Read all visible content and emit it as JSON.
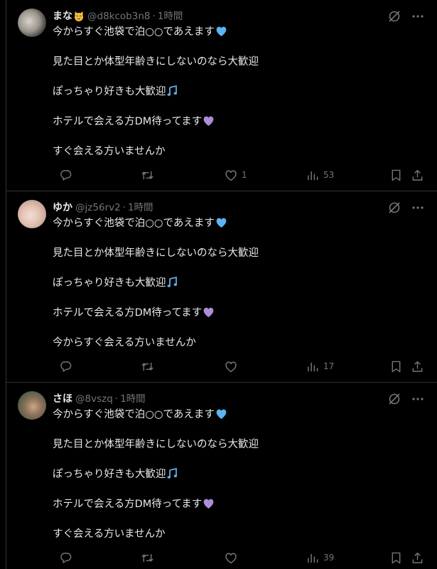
{
  "posts": [
    {
      "name": "まな",
      "name_emoji": "smiling-cat-emoji",
      "handle": "@d8kcob3n8",
      "separator": "·",
      "time": "1時間",
      "lines": [
        "今からすぐ池袋で泊○○であえます",
        "見た目とか体型年齢きにしないのなら大歓迎",
        "ぽっちゃり好きも大歓迎",
        "ホテルで会える方DM待ってます",
        "すぐ会える方いませんか"
      ],
      "likes": "1",
      "views": "53"
    },
    {
      "name": "ゆか",
      "name_emoji": "",
      "handle": "@jz56rv2",
      "separator": "·",
      "time": "1時間",
      "lines": [
        "今からすぐ池袋で泊○○であえます",
        "見た目とか体型年齢きにしないのなら大歓迎",
        "ぽっちゃり好きも大歓迎",
        "ホテルで会える方DM待ってます",
        "今からすぐ会える方いませんか"
      ],
      "likes": "",
      "views": "17"
    },
    {
      "name": "さほ",
      "name_emoji": "",
      "handle": "@8vszq",
      "separator": "·",
      "time": "1時間",
      "lines": [
        "今からすぐ池袋で泊○○であえます",
        "見た目とか体型年齢きにしないのなら大歓迎",
        "ぽっちゃり好きも大歓迎",
        "ホテルで会える方DM待ってます",
        "すぐ会える方いませんか"
      ],
      "likes": "",
      "views": "39"
    }
  ],
  "icons": {
    "grok": "grok-icon",
    "more": "more-icon",
    "reply": "reply-icon",
    "repost": "repost-icon",
    "like": "heart-icon",
    "views": "views-icon",
    "bookmark": "bookmark-icon",
    "share": "share-icon",
    "line1_emoji": "blue-heart-emoji",
    "line3_emoji": "musical-notes-emoji",
    "line4_emoji": "purple-heart-emoji"
  },
  "colors": {
    "background": "#000000",
    "text": "#e7e9ea",
    "muted": "#71767b",
    "divider": "#2f3336",
    "blue_heart": "#5cb4f2",
    "purple_heart": "#aa8ed6",
    "notes": "#5dade2"
  }
}
